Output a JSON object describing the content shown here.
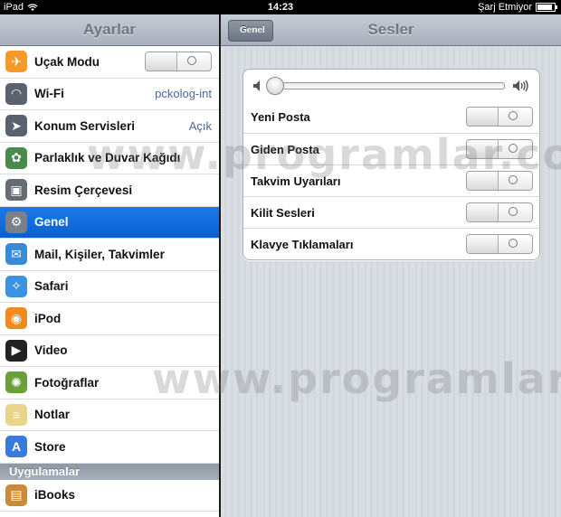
{
  "status_bar": {
    "device": "iPad",
    "time": "14:23",
    "charging": "Şarj Etmiyor"
  },
  "master": {
    "title": "Ayarlar",
    "items": [
      {
        "label": "Uçak Modu",
        "icon": "airplane-icon",
        "icon_color": "#f39a2a",
        "toggle": true
      },
      {
        "label": "Wi-Fi",
        "icon": "wifi-icon",
        "icon_color": "#5a6270",
        "value": "pckolog-int"
      },
      {
        "label": "Konum Servisleri",
        "icon": "location-icon",
        "icon_color": "#5a6270",
        "value": "Açık"
      },
      {
        "label": "Parlaklık ve Duvar Kağıdı",
        "icon": "flower-icon",
        "icon_color": "#4a8a4a"
      },
      {
        "label": "Resim Çerçevesi",
        "icon": "picture-frame-icon",
        "icon_color": "#666c74"
      },
      {
        "label": "Genel",
        "icon": "gear-icon",
        "icon_color": "#7a7f88",
        "selected": true
      },
      {
        "label": "Mail, Kişiler, Takvimler",
        "icon": "mail-icon",
        "icon_color": "#3a8ad8"
      },
      {
        "label": "Safari",
        "icon": "compass-icon",
        "icon_color": "#3a92e0"
      },
      {
        "label": "iPod",
        "icon": "ipod-icon",
        "icon_color": "#f08a1e"
      },
      {
        "label": "Video",
        "icon": "video-icon",
        "icon_color": "#222222"
      },
      {
        "label": "Fotoğraflar",
        "icon": "sunflower-icon",
        "icon_color": "#6aa03a"
      },
      {
        "label": "Notlar",
        "icon": "notes-icon",
        "icon_color": "#e8d58a"
      },
      {
        "label": "Store",
        "icon": "app-store-icon",
        "icon_color": "#3a7ad8"
      }
    ],
    "section_header": "Uygulamalar",
    "apps": [
      {
        "label": "iBooks",
        "icon": "ibooks-icon",
        "icon_color": "#c98a3a"
      }
    ]
  },
  "detail": {
    "title": "Sesler",
    "back_label": "Genel",
    "volume_level": 0,
    "rows": [
      {
        "label": "Yeni Posta"
      },
      {
        "label": "Giden Posta"
      },
      {
        "label": "Takvim Uyarıları"
      },
      {
        "label": "Kilit Sesleri"
      },
      {
        "label": "Klavye Tıklamaları"
      }
    ]
  },
  "watermark": "www.programlar.com"
}
